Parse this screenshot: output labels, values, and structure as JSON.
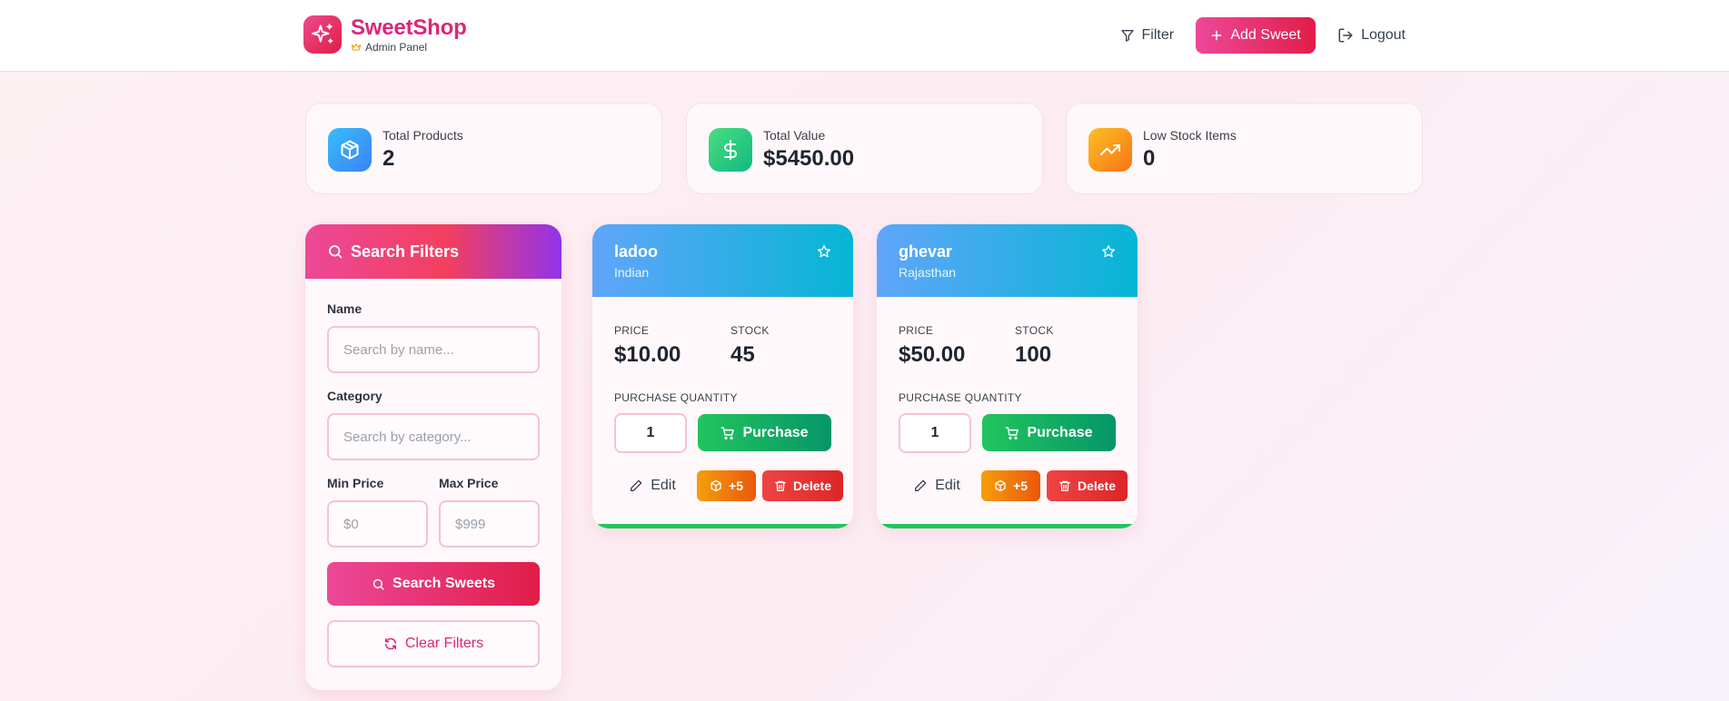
{
  "header": {
    "brand_name": "SweetShop",
    "brand_subtitle": "Admin Panel",
    "filter_label": "Filter",
    "add_label": "Add Sweet",
    "logout_label": "Logout"
  },
  "stats": [
    {
      "label": "Total Products",
      "value": "2",
      "icon": "package-icon",
      "color": "#38bdf8"
    },
    {
      "label": "Total Value",
      "value": "$5450.00",
      "icon": "dollar-icon",
      "color": "#22c55e"
    },
    {
      "label": "Low Stock Items",
      "value": "0",
      "icon": "trending-up-icon",
      "color": "#f59e0b"
    }
  ],
  "filters": {
    "title": "Search Filters",
    "name_label": "Name",
    "name_placeholder": "Search by name...",
    "category_label": "Category",
    "category_placeholder": "Search by category...",
    "min_label": "Min Price",
    "min_placeholder": "$0",
    "max_label": "Max Price",
    "max_placeholder": "$999",
    "search_button": "Search Sweets",
    "clear_button": "Clear Filters"
  },
  "products": [
    {
      "name": "ladoo",
      "category": "Indian",
      "price_label": "PRICE",
      "price": "$10.00",
      "stock_label": "STOCK",
      "stock": "45",
      "quantity_label": "PURCHASE QUANTITY",
      "quantity": "1",
      "purchase_label": "Purchase",
      "edit_label": "Edit",
      "restock_label": "+5",
      "delete_label": "Delete"
    },
    {
      "name": "ghevar",
      "category": "Rajasthan",
      "price_label": "PRICE",
      "price": "$50.00",
      "stock_label": "STOCK",
      "stock": "100",
      "quantity_label": "PURCHASE QUANTITY",
      "quantity": "1",
      "purchase_label": "Purchase",
      "edit_label": "Edit",
      "restock_label": "+5",
      "delete_label": "Delete"
    }
  ],
  "colors": {
    "brand": "#db2777",
    "accent_gradient_start": "#ec4899",
    "accent_gradient_end": "#e11d48",
    "card_header_start": "#60a5fa",
    "card_header_end": "#06b6d4",
    "purchase": "#22c55e",
    "restock": "#f59e0b",
    "delete": "#ef4444"
  }
}
